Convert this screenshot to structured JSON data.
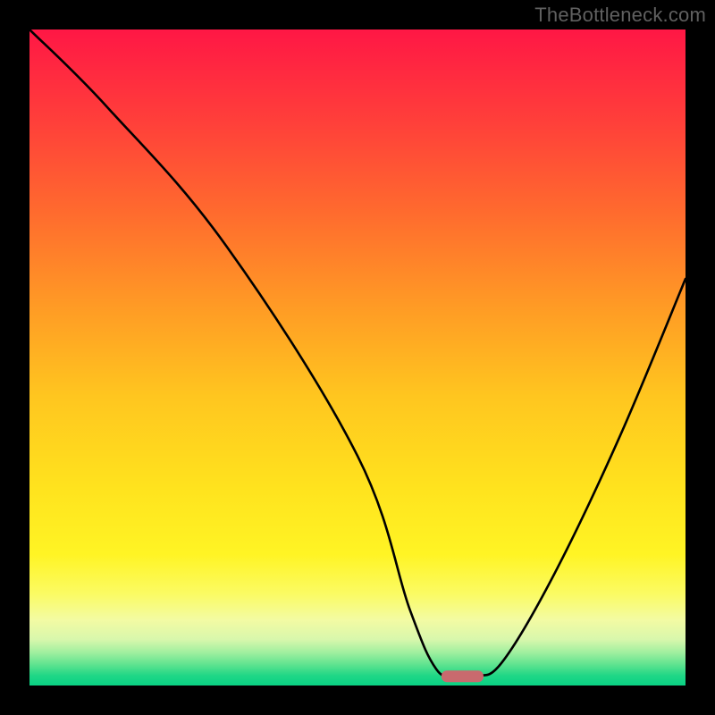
{
  "watermark": "TheBottleneck.com",
  "chart_data": {
    "type": "line",
    "title": "",
    "xlabel": "",
    "ylabel": "",
    "xlim": [
      0,
      100
    ],
    "ylim": [
      0,
      100
    ],
    "grid": false,
    "series": [
      {
        "name": "bottleneck-curve",
        "x": [
          0,
          12,
          30,
          50,
          58,
          62,
          65,
          68,
          72,
          80,
          90,
          100
        ],
        "values": [
          100,
          88,
          67,
          35,
          11.5,
          2.5,
          1.5,
          1.5,
          3.5,
          17,
          38,
          62
        ]
      }
    ],
    "marker": {
      "x_center": 66,
      "x_half_width": 3.2,
      "y": 1.4,
      "color": "#c96a6e"
    },
    "gradient_rows": [
      {
        "y": 100.0,
        "color": "#ff1745"
      },
      {
        "y": 86.0,
        "color": "#ff3f3a"
      },
      {
        "y": 72.0,
        "color": "#ff6b2e"
      },
      {
        "y": 58.0,
        "color": "#ff9a25"
      },
      {
        "y": 44.0,
        "color": "#ffc61f"
      },
      {
        "y": 30.0,
        "color": "#ffe31e"
      },
      {
        "y": 20.0,
        "color": "#fff424"
      },
      {
        "y": 14.0,
        "color": "#fbfb63"
      },
      {
        "y": 10.0,
        "color": "#f3fba3"
      },
      {
        "y": 7.0,
        "color": "#d8f7ac"
      },
      {
        "y": 5.0,
        "color": "#9fef9f"
      },
      {
        "y": 3.0,
        "color": "#58e28e"
      },
      {
        "y": 1.5,
        "color": "#1fd786"
      },
      {
        "y": 0.0,
        "color": "#0ad184"
      }
    ]
  }
}
